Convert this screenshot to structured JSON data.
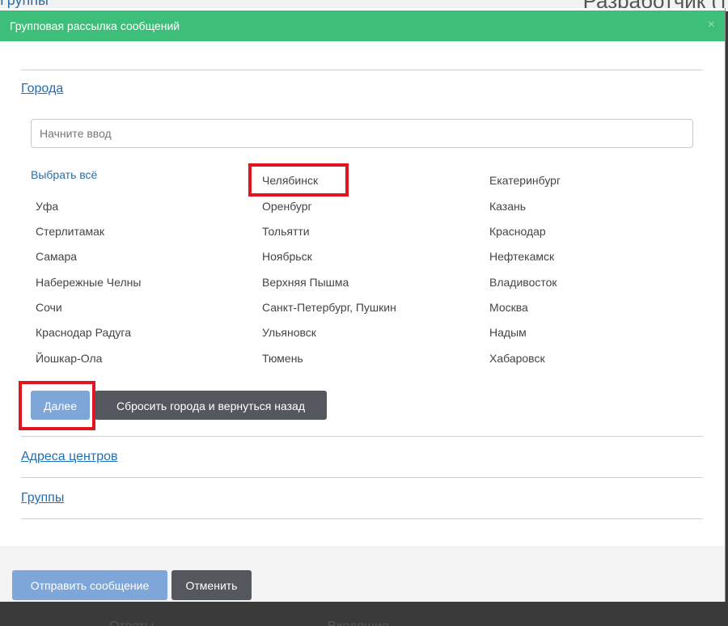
{
  "backdrop": {
    "top_left_text": "Группы",
    "top_right_text": "Разработчик (т",
    "bottom_left_text": "Ответы",
    "bottom_right_text": "Входящие"
  },
  "modal": {
    "title": "Групповая рассылка сообщений",
    "close_glyph": "×"
  },
  "cities_section": {
    "link_label": "Города",
    "search_placeholder": "Начните ввод",
    "select_all_label": "Выбрать всё",
    "columns": [
      [
        "Уфа",
        "Стерлитамак",
        "Самара",
        "Набережные Челны",
        "Сочи",
        "Краснодар Радуга",
        "Йошкар-Ола"
      ],
      [
        "Челябинск",
        "Оренбург",
        "Тольятти",
        "Ноябрьск",
        "Верхняя Пышма",
        "Санкт-Петербург, Пушкин",
        "Ульяновск",
        "Тюмень"
      ],
      [
        "Екатеринбург",
        "Казань",
        "Краснодар",
        "Нефтекамск",
        "Владивосток",
        "Москва",
        "Надым",
        "Хабаровск"
      ]
    ],
    "next_button_label": "Далее",
    "reset_button_label": "Сбросить города и вернуться назад"
  },
  "addresses_section": {
    "link_label": "Адреса центров"
  },
  "groups_section": {
    "link_label": "Группы"
  },
  "footer": {
    "send_button_label": "Отправить сообщение",
    "cancel_button_label": "Отменить"
  },
  "colors": {
    "header_green": "#3dbf7a",
    "link_blue": "#1d6fb8",
    "primary_button": "#7ea6d8",
    "dark_button": "#54585e",
    "highlight_red": "#e0151f"
  }
}
